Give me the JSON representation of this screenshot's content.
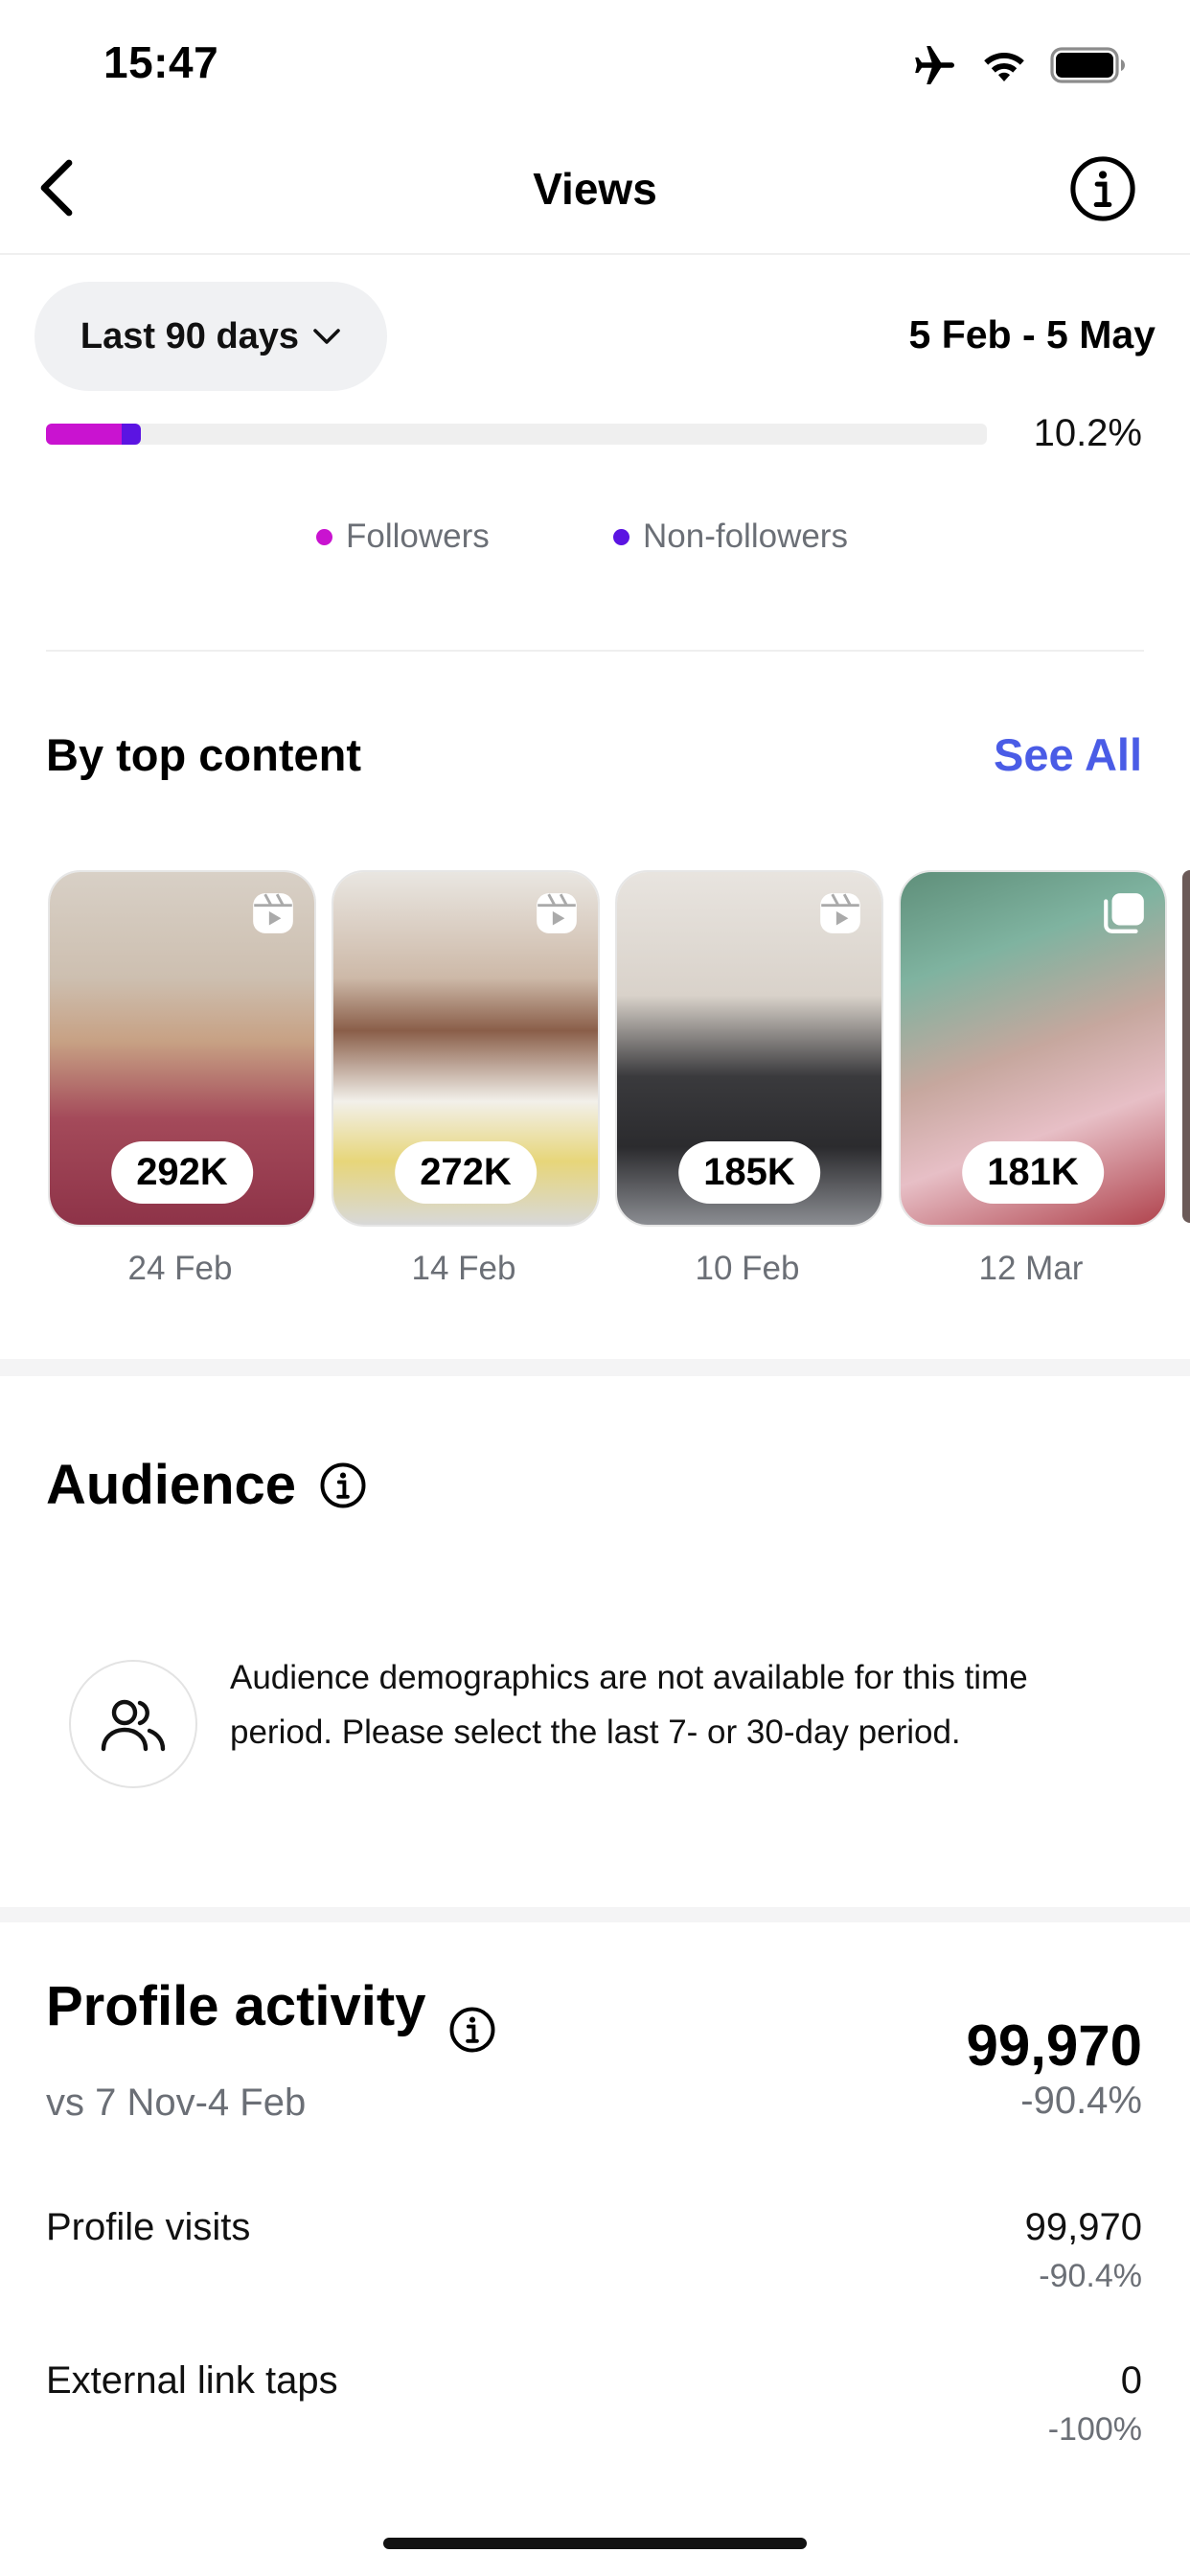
{
  "status_bar": {
    "time": "15:47",
    "icons": [
      "airplane-icon",
      "wifi-icon",
      "battery-icon"
    ]
  },
  "nav": {
    "title": "Views",
    "back_icon": "chevron-left-icon",
    "info_icon": "info-icon"
  },
  "filter": {
    "range_label": "Last 90 days",
    "date_range": "5 Feb - 5 May"
  },
  "audience_split": {
    "bar_value": "10.2%",
    "followers_fraction": 0.08,
    "nonfollowers_fraction": 0.021,
    "legend": [
      {
        "label": "Followers",
        "color": "#c913d0"
      },
      {
        "label": "Non-followers",
        "color": "#5b14e2"
      }
    ]
  },
  "top_content": {
    "title": "By top content",
    "see_all": "See All",
    "items": [
      {
        "views": "292K",
        "date": "24 Feb",
        "type": "reel-icon"
      },
      {
        "views": "272K",
        "date": "14 Feb",
        "type": "reel-icon"
      },
      {
        "views": "185K",
        "date": "10 Feb",
        "type": "reel-icon"
      },
      {
        "views": "181K",
        "date": "12 Mar",
        "type": "carousel-icon"
      }
    ]
  },
  "audience": {
    "title": "Audience",
    "message": "Audience demographics are not available for this time period. Please select the last 7- or 30-day period."
  },
  "profile_activity": {
    "title": "Profile activity",
    "total": "99,970",
    "total_delta": "-90.4%",
    "comparison": "vs 7 Nov-4 Feb",
    "rows": [
      {
        "label": "Profile visits",
        "value": "99,970",
        "delta": "-90.4%"
      },
      {
        "label": "External link taps",
        "value": "0",
        "delta": "-100%"
      }
    ]
  }
}
